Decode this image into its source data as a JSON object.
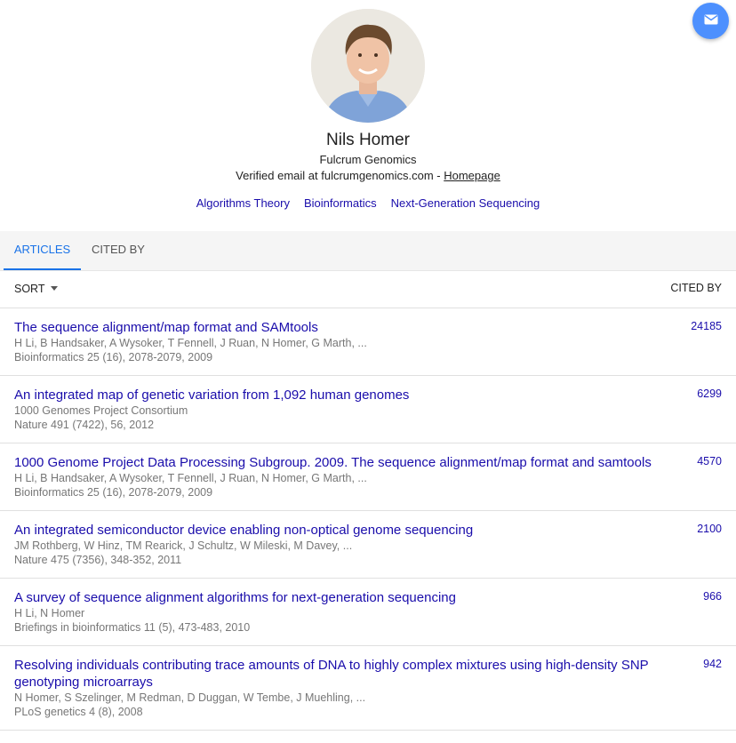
{
  "profile": {
    "name": "Nils Homer",
    "affiliation": "Fulcrum Genomics",
    "email_text": "Verified email at fulcrumgenomics.com - ",
    "homepage_label": "Homepage",
    "interests": [
      "Algorithms Theory",
      "Bioinformatics",
      "Next-Generation Sequencing"
    ]
  },
  "tabs": {
    "articles": "ARTICLES",
    "cited_by": "CITED BY"
  },
  "list_header": {
    "sort_label": "SORT",
    "cited_by_label": "CITED BY"
  },
  "articles": [
    {
      "title": "The sequence alignment/map format and SAMtools",
      "authors": "H Li, B Handsaker, A Wysoker, T Fennell, J Ruan, N Homer, G Marth, ...",
      "venue": "Bioinformatics 25 (16), 2078-2079, 2009",
      "cited_by": "24185"
    },
    {
      "title": "An integrated map of genetic variation from 1,092 human genomes",
      "authors": "1000 Genomes Project Consortium",
      "venue": "Nature 491 (7422), 56, 2012",
      "cited_by": "6299"
    },
    {
      "title": "1000 Genome Project Data Processing Subgroup. 2009. The sequence alignment/map format and samtools",
      "authors": "H Li, B Handsaker, A Wysoker, T Fennell, J Ruan, N Homer, G Marth, ...",
      "venue": "Bioinformatics 25 (16), 2078-2079, 2009",
      "cited_by": "4570"
    },
    {
      "title": "An integrated semiconductor device enabling non-optical genome sequencing",
      "authors": "JM Rothberg, W Hinz, TM Rearick, J Schultz, W Mileski, M Davey, ...",
      "venue": "Nature 475 (7356), 348-352, 2011",
      "cited_by": "2100"
    },
    {
      "title": "A survey of sequence alignment algorithms for next-generation sequencing",
      "authors": "H Li, N Homer",
      "venue": "Briefings in bioinformatics 11 (5), 473-483, 2010",
      "cited_by": "966"
    },
    {
      "title": "Resolving individuals contributing trace amounts of DNA to highly complex mixtures using high-density SNP genotyping microarrays",
      "authors": "N Homer, S Szelinger, M Redman, D Duggan, W Tembe, J Muehling, ...",
      "venue": "PLoS genetics 4 (8), 2008",
      "cited_by": "942"
    }
  ],
  "icons": {
    "fab": "email-icon",
    "sort": "caret-down-icon"
  },
  "colors": {
    "link": "#1a0dab",
    "tab_active": "#1a73e8",
    "fab": "#4d90fe",
    "meta_text": "#777777"
  }
}
